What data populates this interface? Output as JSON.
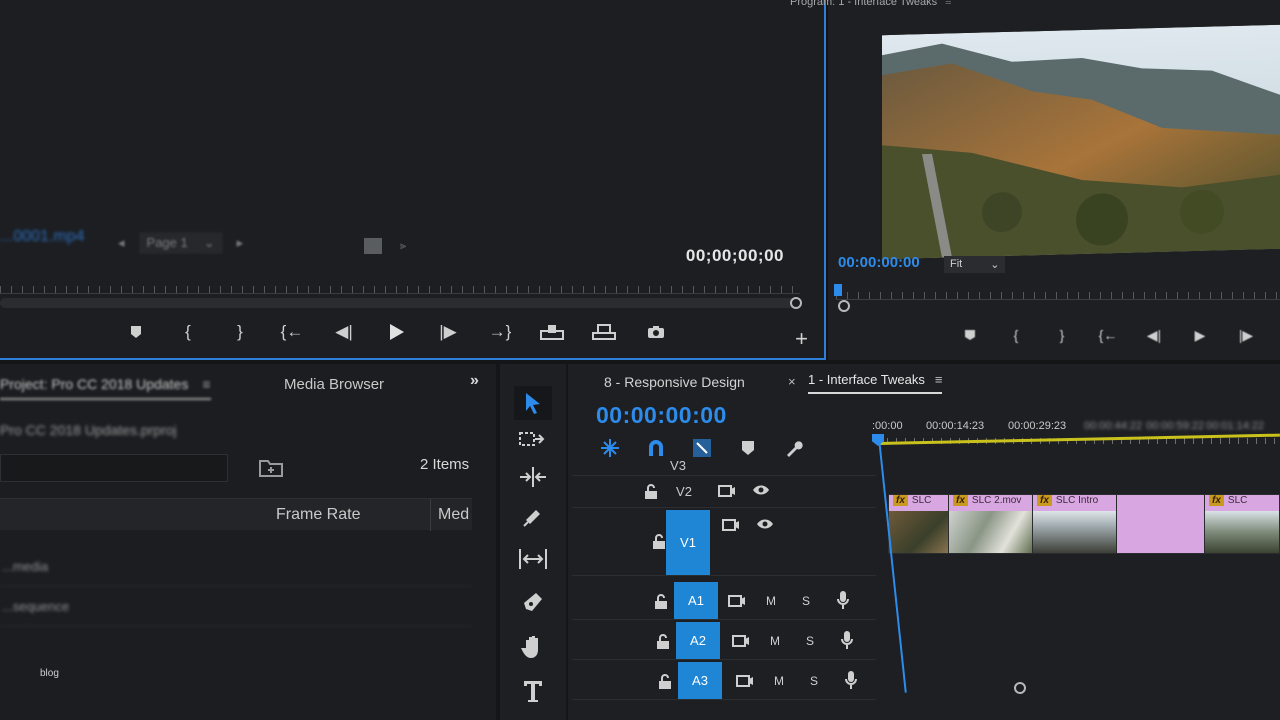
{
  "source_monitor": {
    "clip_name": "...0001.mp4",
    "page_label": "Page 1",
    "timecode": "00;00;00;00",
    "controls": [
      "marker-icon",
      "mark-in-icon",
      "mark-out-icon",
      "go-to-in-icon",
      "step-back-icon",
      "play-icon",
      "step-forward-icon",
      "go-to-out-icon",
      "insert-icon",
      "overwrite-icon",
      "export-frame-icon"
    ],
    "add_button": "+"
  },
  "program_monitor": {
    "title": "Program: 1 - Interface Tweaks",
    "timecode": "00:00:00:00",
    "fit_label": "Fit"
  },
  "project_panel": {
    "tab_project": "Project: Pro CC 2018 Updates",
    "tab_media_browser": "Media Browser",
    "more_label": "»",
    "project_file": "Pro CC 2018 Updates.prproj",
    "item_count": "2 Items",
    "columns": [
      "Frame Rate",
      "Med"
    ],
    "rows": [
      "...media",
      "...sequence"
    ],
    "watermark": "blog"
  },
  "tools": [
    "selection-tool-icon",
    "track-select-forward-icon",
    "ripple-edit-icon",
    "razor-icon",
    "slip-icon",
    "pen-icon",
    "hand-icon",
    "type-icon"
  ],
  "timeline": {
    "tab_inactive": "8 - Responsive Design",
    "close_label": "×",
    "tab_active": "1 - Interface Tweaks",
    "timecode": "00:00:00:00",
    "ruler_labels": [
      ":00:00",
      "00:00:14:23",
      "00:00:29:23",
      "00:00:44:22",
      "00:00:59:22",
      "00:01:14:22"
    ],
    "tracks": [
      {
        "name": "V3",
        "type": "video"
      },
      {
        "name": "V2",
        "type": "video"
      },
      {
        "name": "V1",
        "type": "video",
        "targeted": true
      },
      {
        "name": "A1",
        "type": "audio",
        "targeted": true
      },
      {
        "name": "A2",
        "type": "audio",
        "targeted": true
      },
      {
        "name": "A3",
        "type": "audio",
        "targeted": true
      }
    ],
    "mute_label": "M",
    "solo_label": "S",
    "clips": [
      {
        "label": "SLC",
        "fx": "fx"
      },
      {
        "label": "SLC 2.mov",
        "fx": "fx"
      },
      {
        "label": "SLC Intro",
        "fx": "fx"
      },
      {
        "label": "",
        "fx": ""
      },
      {
        "label": "SLC",
        "fx": "fx"
      }
    ]
  },
  "colors": {
    "accent_blue": "#2d8ceb",
    "clip_label": "#d8a6e0",
    "work_area": "#c9c21c",
    "panel_bg": "#1d1f22"
  }
}
